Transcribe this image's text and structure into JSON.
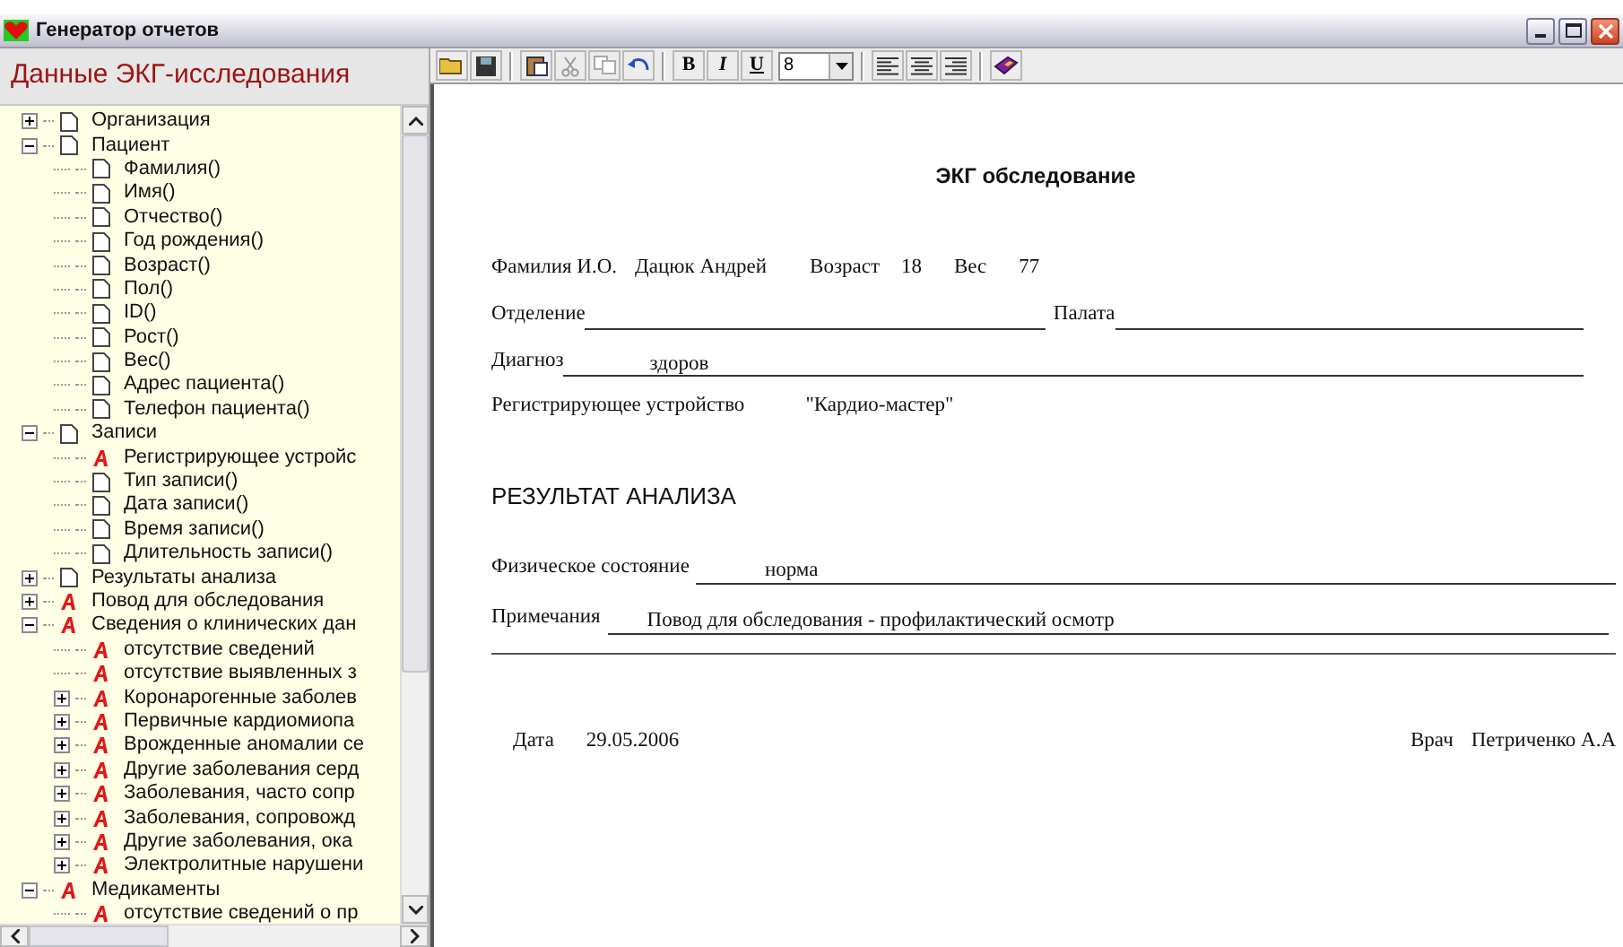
{
  "window": {
    "title": "Генератор отчетов"
  },
  "panel_title": "Данные ЭКГ-исследования",
  "tree": [
    {
      "label": "Организация",
      "kind": "page",
      "expanded": false
    },
    {
      "label": "Пациент",
      "kind": "page",
      "expanded": true,
      "children": [
        {
          "label": "Фамилия()",
          "kind": "page"
        },
        {
          "label": "Имя()",
          "kind": "page"
        },
        {
          "label": "Отчество()",
          "kind": "page"
        },
        {
          "label": "Год рождения()",
          "kind": "page"
        },
        {
          "label": "Возраст()",
          "kind": "page"
        },
        {
          "label": "Пол()",
          "kind": "page"
        },
        {
          "label": "ID()",
          "kind": "page"
        },
        {
          "label": "Рост()",
          "kind": "page"
        },
        {
          "label": "Вес()",
          "kind": "page"
        },
        {
          "label": "Адрес пациента()",
          "kind": "page"
        },
        {
          "label": "Телефон пациента()",
          "kind": "page"
        }
      ]
    },
    {
      "label": "Записи",
      "kind": "page",
      "expanded": true,
      "children": [
        {
          "label": "Регистрирующее устройс",
          "kind": "attr"
        },
        {
          "label": "Тип записи()",
          "kind": "page"
        },
        {
          "label": "Дата записи()",
          "kind": "page"
        },
        {
          "label": "Время записи()",
          "kind": "page"
        },
        {
          "label": "Длительность записи()",
          "kind": "page"
        }
      ]
    },
    {
      "label": "Результаты анализа",
      "kind": "page",
      "expanded": false
    },
    {
      "label": "Повод для обследования",
      "kind": "attr",
      "expanded": false
    },
    {
      "label": "Сведения о клинических дан",
      "kind": "attr",
      "expanded": true,
      "children": [
        {
          "label": "отсутствие сведений",
          "kind": "attr"
        },
        {
          "label": "отсутствие выявленных з",
          "kind": "attr"
        },
        {
          "label": "Коронарогенные заболев",
          "kind": "attr",
          "expanded": false
        },
        {
          "label": "Первичные кардиомиопа",
          "kind": "attr",
          "expanded": false
        },
        {
          "label": "Врожденные аномалии се",
          "kind": "attr",
          "expanded": false
        },
        {
          "label": "Другие заболевания серд",
          "kind": "attr",
          "expanded": false
        },
        {
          "label": "Заболевания, часто сопр",
          "kind": "attr",
          "expanded": false
        },
        {
          "label": "Заболевания, сопровожд",
          "kind": "attr",
          "expanded": false
        },
        {
          "label": "Другие заболевания, ока",
          "kind": "attr",
          "expanded": false
        },
        {
          "label": "Электролитные нарушени",
          "kind": "attr",
          "expanded": false
        }
      ]
    },
    {
      "label": "Медикаменты",
      "kind": "attr",
      "expanded": true,
      "children": [
        {
          "label": "отсутствие сведений о пр",
          "kind": "attr"
        }
      ]
    }
  ],
  "toolbar": {
    "bold": "B",
    "italic": "I",
    "underline": "U",
    "font_size": "8"
  },
  "document": {
    "title": "ЭКГ обследование",
    "name_label": "Фамилия И.О.",
    "name": "Дацюк Андрей",
    "age_label": "Возраст",
    "age": "18",
    "weight_label": "Вес",
    "weight": "77",
    "department_label": "Отделение",
    "ward_label": "Палата",
    "diagnosis_label": "Диагноз",
    "diagnosis": "здоров",
    "device_label": "Регистрирующее устройство",
    "device": "\"Кардио-мастер\"",
    "section_title": "РЕЗУЛЬТАТ АНАЛИЗА",
    "condition_label": "Физическое состояние",
    "condition": "норма",
    "notes_label": "Примечания",
    "notes": "Повод для обследования - профилактический осмотр",
    "date_label": "Дата",
    "date": "29.05.2006",
    "doctor_label": "Врач",
    "doctor": "Петриченко А.А"
  }
}
